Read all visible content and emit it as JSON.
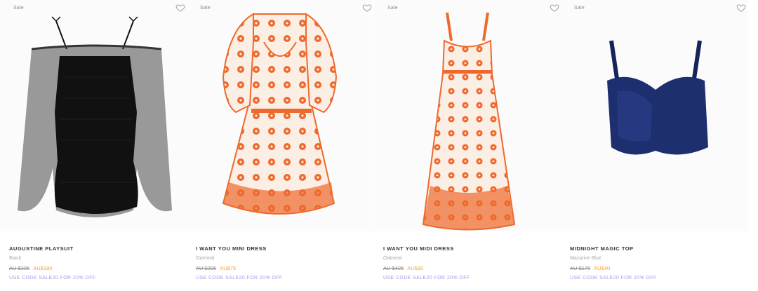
{
  "products": [
    {
      "sale_tag": "Sale",
      "name": "AUGUSTINE PLAYSUIT",
      "color": "Black",
      "old_price": "AU $395",
      "new_price": "AU$180",
      "promo": "USE CODE SALE20 FOR 20% OFF"
    },
    {
      "sale_tag": "Sale",
      "name": "I WANT YOU MINI DRESS",
      "color": "Oatmeal",
      "old_price": "AU $395",
      "new_price": "AU$75",
      "promo": "USE CODE SALE20 FOR 20% OFF"
    },
    {
      "sale_tag": "Sale",
      "name": "I WANT YOU MIDI DRESS",
      "color": "Oatmeal",
      "old_price": "AU $425",
      "new_price": "AU$90",
      "promo": "USE CODE SALE20 FOR 20% OFF"
    },
    {
      "sale_tag": "Sale",
      "name": "MIDNIGHT MAGIC TOP",
      "color": "Mazarine Blue",
      "old_price": "AU $175",
      "new_price": "AU$40",
      "promo": "USE CODE SALE20 FOR 20% OFF"
    }
  ],
  "colors": {
    "sale_price": "#f0a53c",
    "promo": "#a79be3",
    "dress_orange": "#ee6a2c",
    "dress_base": "#fbeee4",
    "playsuit": "#1a1a1a",
    "top_blue": "#1e2f70"
  }
}
